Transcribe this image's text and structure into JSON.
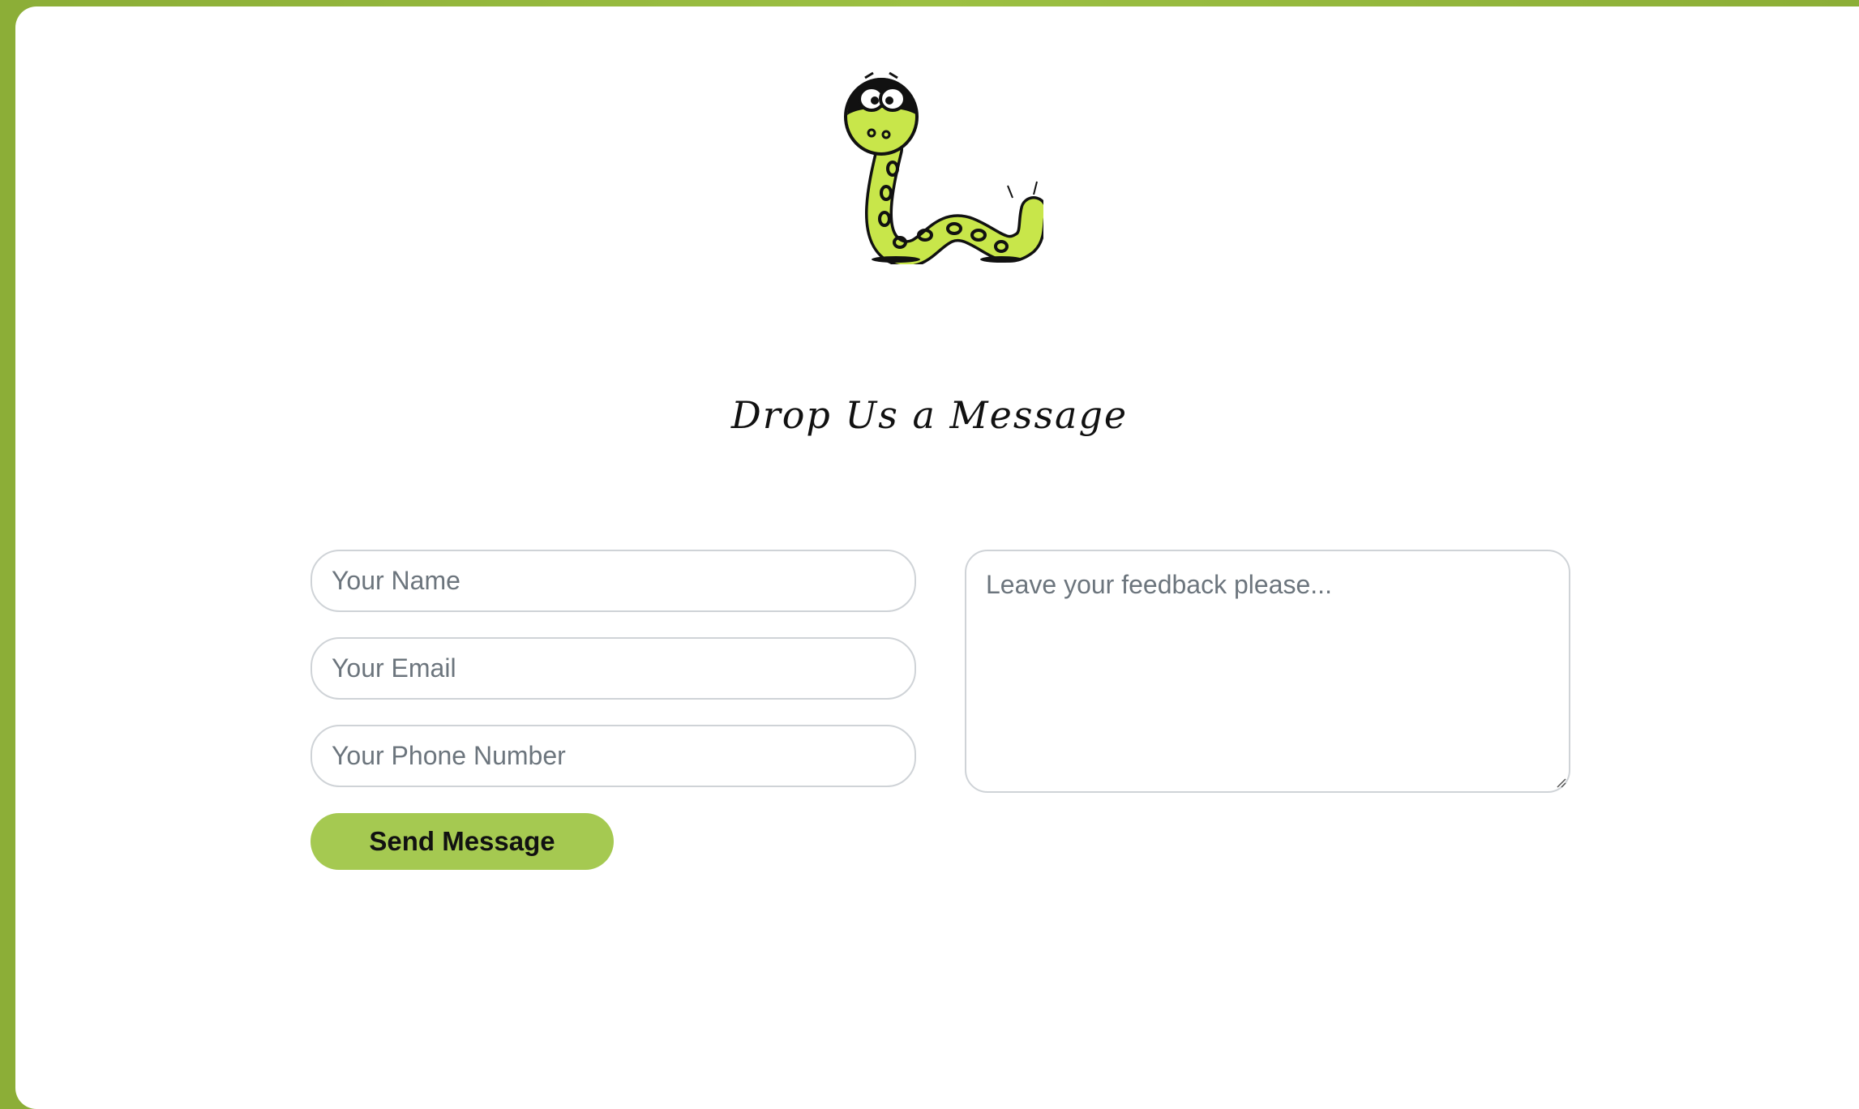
{
  "header": {
    "logo_icon": "snake-mascot-icon",
    "title": "Drop Us a Message"
  },
  "form": {
    "name_placeholder": "Your Name",
    "email_placeholder": "Your Email",
    "phone_placeholder": "Your Phone Number",
    "feedback_placeholder": "Leave your feedback please...",
    "send_label": "Send Message"
  },
  "colors": {
    "page_background": "#8fb43a",
    "accent": "#a5c951",
    "snake_green": "#c8e64a"
  }
}
